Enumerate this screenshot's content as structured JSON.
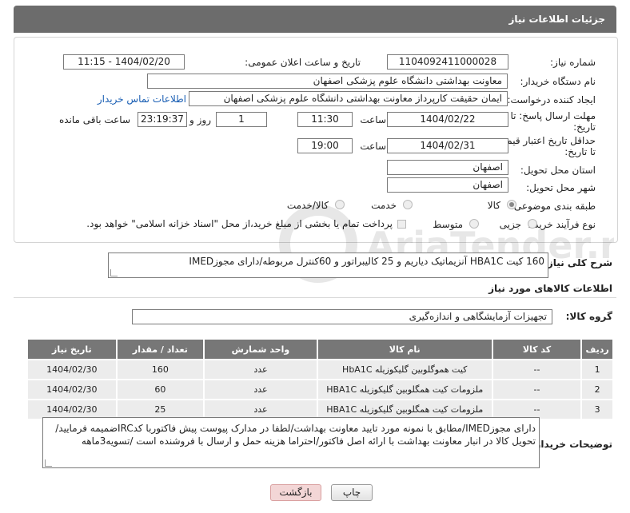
{
  "panel": {
    "title": "جزئیات اطلاعات نیاز"
  },
  "form": {
    "need_no_label": "شماره نیاز:",
    "need_no_value": "1104092411000028",
    "announce_label": "تاریخ و ساعت اعلان عمومی:",
    "announce_value": "1404/02/20 - 11:15",
    "buyer_org_label": "نام دستگاه خریدار:",
    "buyer_org_value": "معاونت بهداشتی دانشگاه علوم پزشکی اصفهان",
    "creator_label": "ایجاد کننده درخواست:",
    "creator_value": "ایمان حقیقت کارپرداز معاونت بهداشتی دانشگاه علوم پزشکی اصفهان",
    "contact_link": "اطلاعات تماس خریدار",
    "deadline_label_1": "مهلت ارسال پاسخ: تا",
    "deadline_label_2": "تاریخ:",
    "deadline_date": "1404/02/22",
    "time_word": "ساعت",
    "deadline_time": "11:30",
    "days_value": "1",
    "day_word": "روز و",
    "remaining_value": "23:19:37",
    "remaining_label": "ساعت باقی مانده",
    "validity_label_1": "حداقل تاریخ اعتبار قیمت:",
    "validity_label_2": "تا تاریخ:",
    "validity_date": "1404/02/31",
    "validity_time": "19:00",
    "province_label": "استان محل تحویل:",
    "province_value": "اصفهان",
    "city_label": "شهر محل تحویل:",
    "city_value": "اصفهان",
    "category_label": "طبقه بندی موضوعی:",
    "category_options": [
      "کالا",
      "خدمت",
      "کالا/خدمت"
    ],
    "category_selected": "کالا",
    "process_label": "نوع فرآیند خرید :",
    "process_options": [
      "جزیی",
      "متوسط"
    ],
    "process_note": "پرداخت تمام یا بخشی از مبلغ خرید،از محل \"اسناد خزانه اسلامی\" خواهد بود."
  },
  "description": {
    "label": "شرح کلی نیاز:",
    "value": "160 کیت HBA1C آنزیماتیک دیاریم و 25 کالیبراتور و 60کنترل مربوطه/دارای مجوزIMED"
  },
  "goods": {
    "section_title": "اطلاعات کالاهای مورد نیاز",
    "group_label": "گروه کالا:",
    "group_value": "تجهیزات آزمایشگاهی و اندازه‌گیری",
    "columns": [
      "ردیف",
      "کد کالا",
      "نام کالا",
      "واحد شمارش",
      "تعداد / مقدار",
      "تاریخ نیاز"
    ],
    "rows": [
      [
        "1",
        "--",
        "کیت هموگلوبین گلیکوزیله HbA1C",
        "عدد",
        "160",
        "1404/02/30"
      ],
      [
        "2",
        "--",
        "ملزومات کیت همگلوبین گلیکوزیله HBA1C",
        "عدد",
        "60",
        "1404/02/30"
      ],
      [
        "3",
        "--",
        "ملزومات کیت همگلوبین گلیکوزیله HBA1C",
        "عدد",
        "25",
        "1404/02/30"
      ]
    ]
  },
  "notes": {
    "label": "توضیحات خریدار:",
    "value": "دارای مجوزIMED/مطابق با نمونه مورد تایید معاونت بهداشت/لطفا در مدارک پیوست پیش فاکتوربا کدIRCضمیمه فرمایید/تحویل کالا در انبار معاونت بهداشت با ارائه اصل فاکتور/احتراما هزینه حمل و ارسال با فروشنده است /تسویه3ماهه"
  },
  "buttons": {
    "print": "چاپ",
    "back": "بازگشت"
  },
  "watermark": {
    "text": "AriaTender.net"
  },
  "colors": {
    "header_bg": "#6c6c6c",
    "table_header_bg": "#777777",
    "link": "#1a5fb4"
  }
}
